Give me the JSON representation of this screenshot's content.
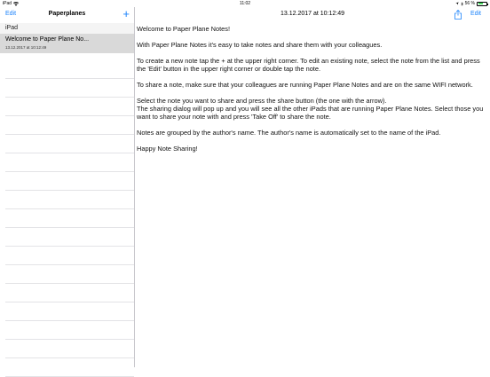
{
  "status": {
    "device": "iPad",
    "time": "11:02",
    "battery": "56 %",
    "battery_level": 0.56
  },
  "sidebar": {
    "edit_label": "Edit",
    "title": "Paperplanes",
    "add_label": "+",
    "section": "iPad",
    "notes": [
      {
        "title": "Welcome to Paper Plane No...",
        "date": "13.12.2017 at 10:12:49"
      }
    ]
  },
  "detail": {
    "title": "13.12.2017 at 10:12:49",
    "edit_label": "Edit",
    "paragraphs": [
      "Welcome to Paper Plane Notes!",
      "With Paper Plane Notes it's easy to take notes and share them with your colleagues.",
      "To create a new note tap the + at the upper right corner. To edit an existing note, select the note from the list and press the 'Edit' button in the upper right corner or double tap the note.",
      "To share a note, make sure that your colleagues are running Paper Plane Notes and are on the same WIFI network.",
      "Select the note you want to share and press the share button (the one with the arrow).\nThe sharing dialog will pop up and you will see all the other iPads that are running Paper Plane Notes. Select those you want to share your note with and press 'Take Off' to share the note.",
      "Notes are grouped by the author's name. The author's name is automatically set to the name of the iPad.",
      "Happy Note Sharing!"
    ]
  },
  "colors": {
    "accent": "#1a82fb",
    "selected_row": "#d9d9d9",
    "battery": "#4cd964"
  }
}
